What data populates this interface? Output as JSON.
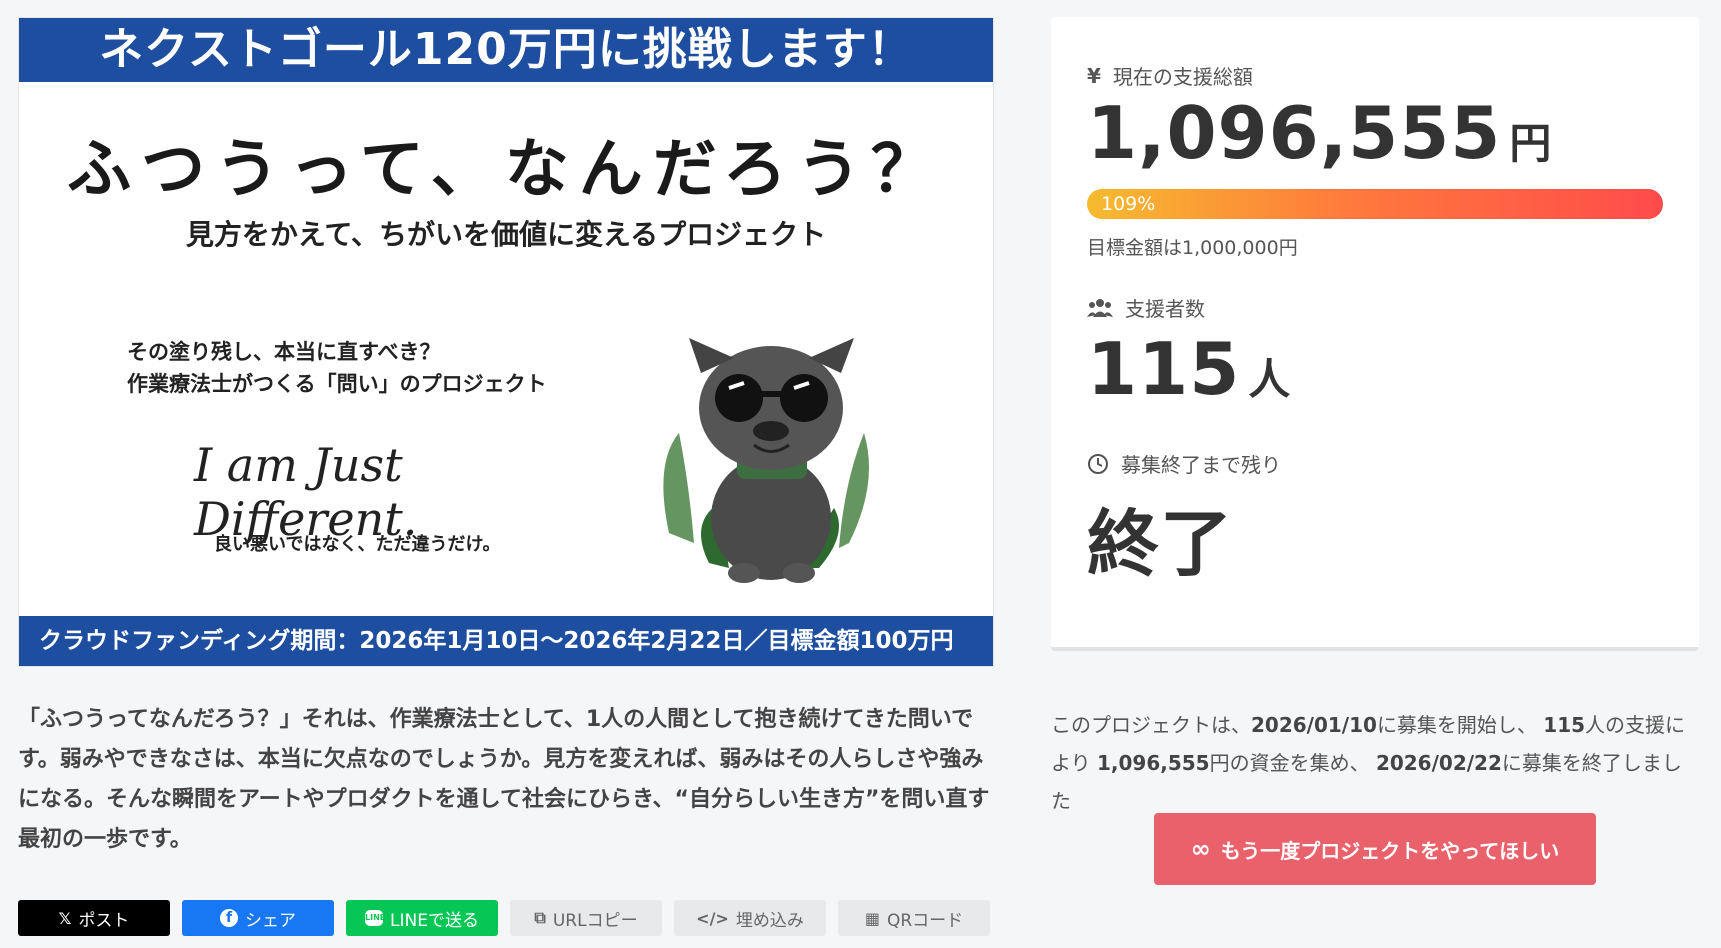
{
  "hero": {
    "banner_top": "ネクストゴール120万円に挑戦します！",
    "title": "ふつうって、なんだろう？",
    "subtitle": "見方をかえて、ちがいを価値に変えるプロジェクト",
    "question_line1": "その塗り残し、本当に直すべき？",
    "question_line2": "作業療法士がつくる「問い」のプロジェクト",
    "script_text": "I am Just Different.",
    "tagline": "良い悪いではなく、ただ違うだけ。",
    "banner_bottom": "クラウドファンディング期間：2026年1月10日〜2026年2月22日／目標金額100万円"
  },
  "description": "「ふつうってなんだろう？」それは、作業療法士として、1人の人間として抱き続けてきた問いです。弱みやできなさは、本当に欠点なのでしょうか。見方を変えれば、弱みはその人らしさや強みになる。そんな瞬間をアートやプロダクトを通して社会にひらき、“自分らしい生き方”を問い直す最初の一歩です。",
  "share": {
    "x_label": "ポスト",
    "facebook_label": "シェア",
    "line_label": "LINEで送る",
    "url_copy_label": "URLコピー",
    "embed_label": "埋め込み",
    "qr_label": "QRコード"
  },
  "stats": {
    "funding_label": "現在の支援総額",
    "funding_amount": "1,096,555",
    "funding_unit": "円",
    "progress_percent_label": "109%",
    "progress_percent": 109,
    "goal_text": "目標金額は1,000,000円",
    "supporters_label": "支援者数",
    "supporters_count": "115",
    "supporters_unit": "人",
    "remaining_label": "募集終了まで残り",
    "remaining_value": "終了"
  },
  "summary": {
    "p1": "このプロジェクトは、",
    "start_date": "2026/01/10",
    "p2": "に募集を開始し、 ",
    "count": "115",
    "p3": "人の支援により ",
    "amount": "1,096,555",
    "p4": "円の資金を集め、 ",
    "end_date": "2026/02/22",
    "p5": "に募集を終了しました"
  },
  "again_button": {
    "icon": "∞",
    "label": "もう一度プロジェクトをやってほしい"
  },
  "colors": {
    "banner_blue": "#1e4ea0",
    "accent_red": "#e9616b",
    "line_green": "#06c755",
    "facebook_blue": "#1877f2"
  }
}
